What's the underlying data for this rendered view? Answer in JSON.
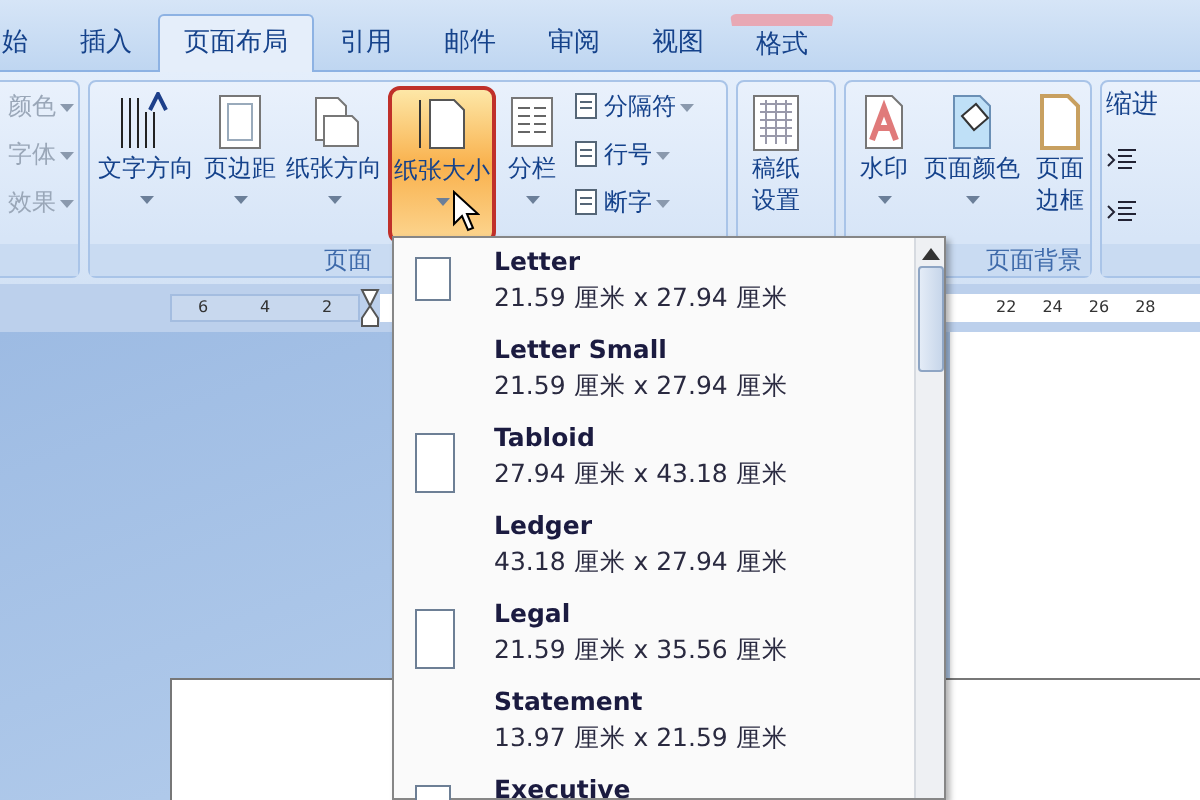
{
  "tabs": [
    {
      "label": "始",
      "selected": false,
      "contextual": false
    },
    {
      "label": "插入",
      "selected": false,
      "contextual": false
    },
    {
      "label": "页面布局",
      "selected": true,
      "contextual": false
    },
    {
      "label": "引用",
      "selected": false,
      "contextual": false
    },
    {
      "label": "邮件",
      "selected": false,
      "contextual": false
    },
    {
      "label": "审阅",
      "selected": false,
      "contextual": false
    },
    {
      "label": "视图",
      "selected": false,
      "contextual": false
    },
    {
      "label": "格式",
      "selected": false,
      "contextual": true
    }
  ],
  "ribbon": {
    "groups": [
      {
        "buttons": [
          {
            "kind": "small",
            "label": "颜色",
            "dropdown": true,
            "disabled": true
          },
          {
            "kind": "small",
            "label": "字体",
            "dropdown": true,
            "disabled": true
          },
          {
            "kind": "small",
            "label": "效果",
            "dropdown": true,
            "disabled": true
          }
        ]
      },
      {
        "label": "页面",
        "buttons": [
          {
            "kind": "large",
            "label": "文字方向",
            "dropdown": true,
            "highlighted": false
          },
          {
            "kind": "large",
            "label": "页边距",
            "dropdown": true,
            "highlighted": false
          },
          {
            "kind": "large",
            "label": "纸张方向",
            "dropdown": true,
            "highlighted": false
          },
          {
            "kind": "large",
            "label": "纸张大小",
            "dropdown": true,
            "highlighted": true
          },
          {
            "kind": "large",
            "label": "分栏",
            "dropdown": true,
            "highlighted": false
          },
          {
            "kind": "small",
            "label": "分隔符",
            "dropdown": true,
            "disabled": false
          },
          {
            "kind": "small",
            "label": "行号",
            "dropdown": true,
            "disabled": false
          },
          {
            "kind": "small",
            "label": "断字",
            "dropdown": true,
            "disabled": false
          }
        ]
      },
      {
        "buttons": [
          {
            "kind": "large",
            "lines": [
              "稿纸",
              "设置"
            ],
            "dropdown": false,
            "highlighted": false
          }
        ]
      },
      {
        "label": "页面背景",
        "buttons": [
          {
            "kind": "large",
            "label": "水印",
            "dropdown": true,
            "highlighted": false
          },
          {
            "kind": "large",
            "label": "页面颜色",
            "dropdown": true,
            "highlighted": false
          },
          {
            "kind": "large",
            "lines": [
              "页面",
              "边框"
            ],
            "dropdown": false,
            "highlighted": false
          }
        ]
      },
      {
        "buttons": [
          {
            "kind": "heading",
            "label": "缩进"
          },
          {
            "kind": "iconrow"
          },
          {
            "kind": "iconrow"
          }
        ]
      }
    ]
  },
  "ruler": {
    "left_numbers": [
      "6",
      "4",
      "2"
    ],
    "right_numbers": [
      "22",
      "24",
      "26",
      "28"
    ]
  },
  "paper_sizes": [
    {
      "name": "Letter",
      "size": "21.59 厘米 x 27.94 厘米",
      "has_icon": true
    },
    {
      "name": "Letter Small",
      "size": "21.59 厘米 x 27.94 厘米",
      "has_icon": false
    },
    {
      "name": "Tabloid",
      "size": "27.94 厘米 x 43.18 厘米",
      "has_icon": true
    },
    {
      "name": "Ledger",
      "size": "43.18 厘米 x 27.94 厘米",
      "has_icon": false
    },
    {
      "name": "Legal",
      "size": "21.59 厘米 x 35.56 厘米",
      "has_icon": true
    },
    {
      "name": "Statement",
      "size": "13.97 厘米 x 21.59 厘米",
      "has_icon": false
    },
    {
      "name": "Executive",
      "has_icon": true
    }
  ]
}
